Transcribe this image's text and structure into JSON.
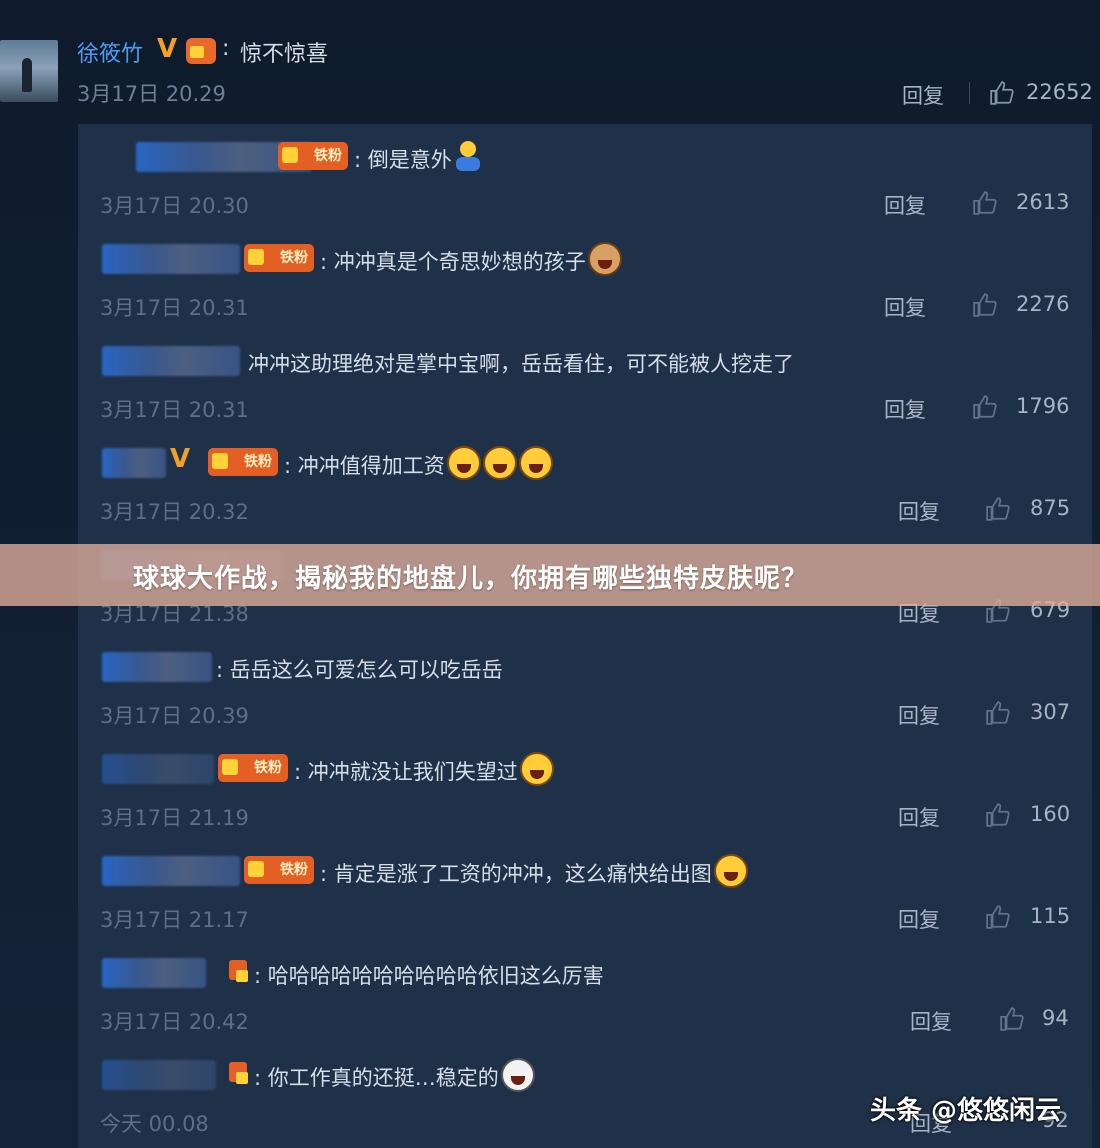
{
  "top_comment": {
    "username": "徐筱竹",
    "v_badge": "V",
    "colon": ":",
    "text": "惊不惊喜",
    "time": "3月17日 20.29",
    "reply_label": "回复",
    "likes": "22652"
  },
  "replies": [
    {
      "badge": "铁粉",
      "text": "倒是意外",
      "time": "3月17日 20.30",
      "reply_label": "回复",
      "likes": "2613"
    },
    {
      "badge": "铁粉",
      "text": "冲冲真是个奇思妙想的孩子",
      "time": "3月17日 20.31",
      "reply_label": "回复",
      "likes": "2276"
    },
    {
      "text": "冲冲这助理绝对是掌中宝啊，岳岳看住，可不能被人挖走了",
      "time": "3月17日 20.31",
      "reply_label": "回复",
      "likes": "1796"
    },
    {
      "badge": "铁粉",
      "text": "冲冲值得加工资",
      "time": "3月17日 20.32",
      "reply_label": "回复",
      "likes": "875"
    },
    {
      "text": "",
      "time": "3月17日 21.38",
      "reply_label": "回复",
      "likes": "679"
    },
    {
      "text": "岳岳这么可爱怎么可以吃岳岳",
      "time": "3月17日 20.39",
      "reply_label": "回复",
      "likes": "307"
    },
    {
      "badge": "铁粉",
      "text": "冲冲就没让我们失望过",
      "time": "3月17日 21.19",
      "reply_label": "回复",
      "likes": "160"
    },
    {
      "badge": "铁粉",
      "text": "肯定是涨了工资的冲冲，这么痛快给出图",
      "time": "3月17日 21.17",
      "reply_label": "回复",
      "likes": "115"
    },
    {
      "text": "哈哈哈哈哈哈哈哈哈哈依旧这么厉害",
      "time": "3月17日 20.42",
      "reply_label": "回复",
      "likes": "94"
    },
    {
      "text": "你工作真的还挺…稳定的",
      "time": "今天 00.08",
      "reply_label": "回复",
      "likes": "92"
    }
  ],
  "banner": {
    "title": "球球大作战，揭秘我的地盘儿，你拥有哪些独特皮肤呢？"
  },
  "watermark": {
    "text": "头条 @悠悠闲云"
  }
}
